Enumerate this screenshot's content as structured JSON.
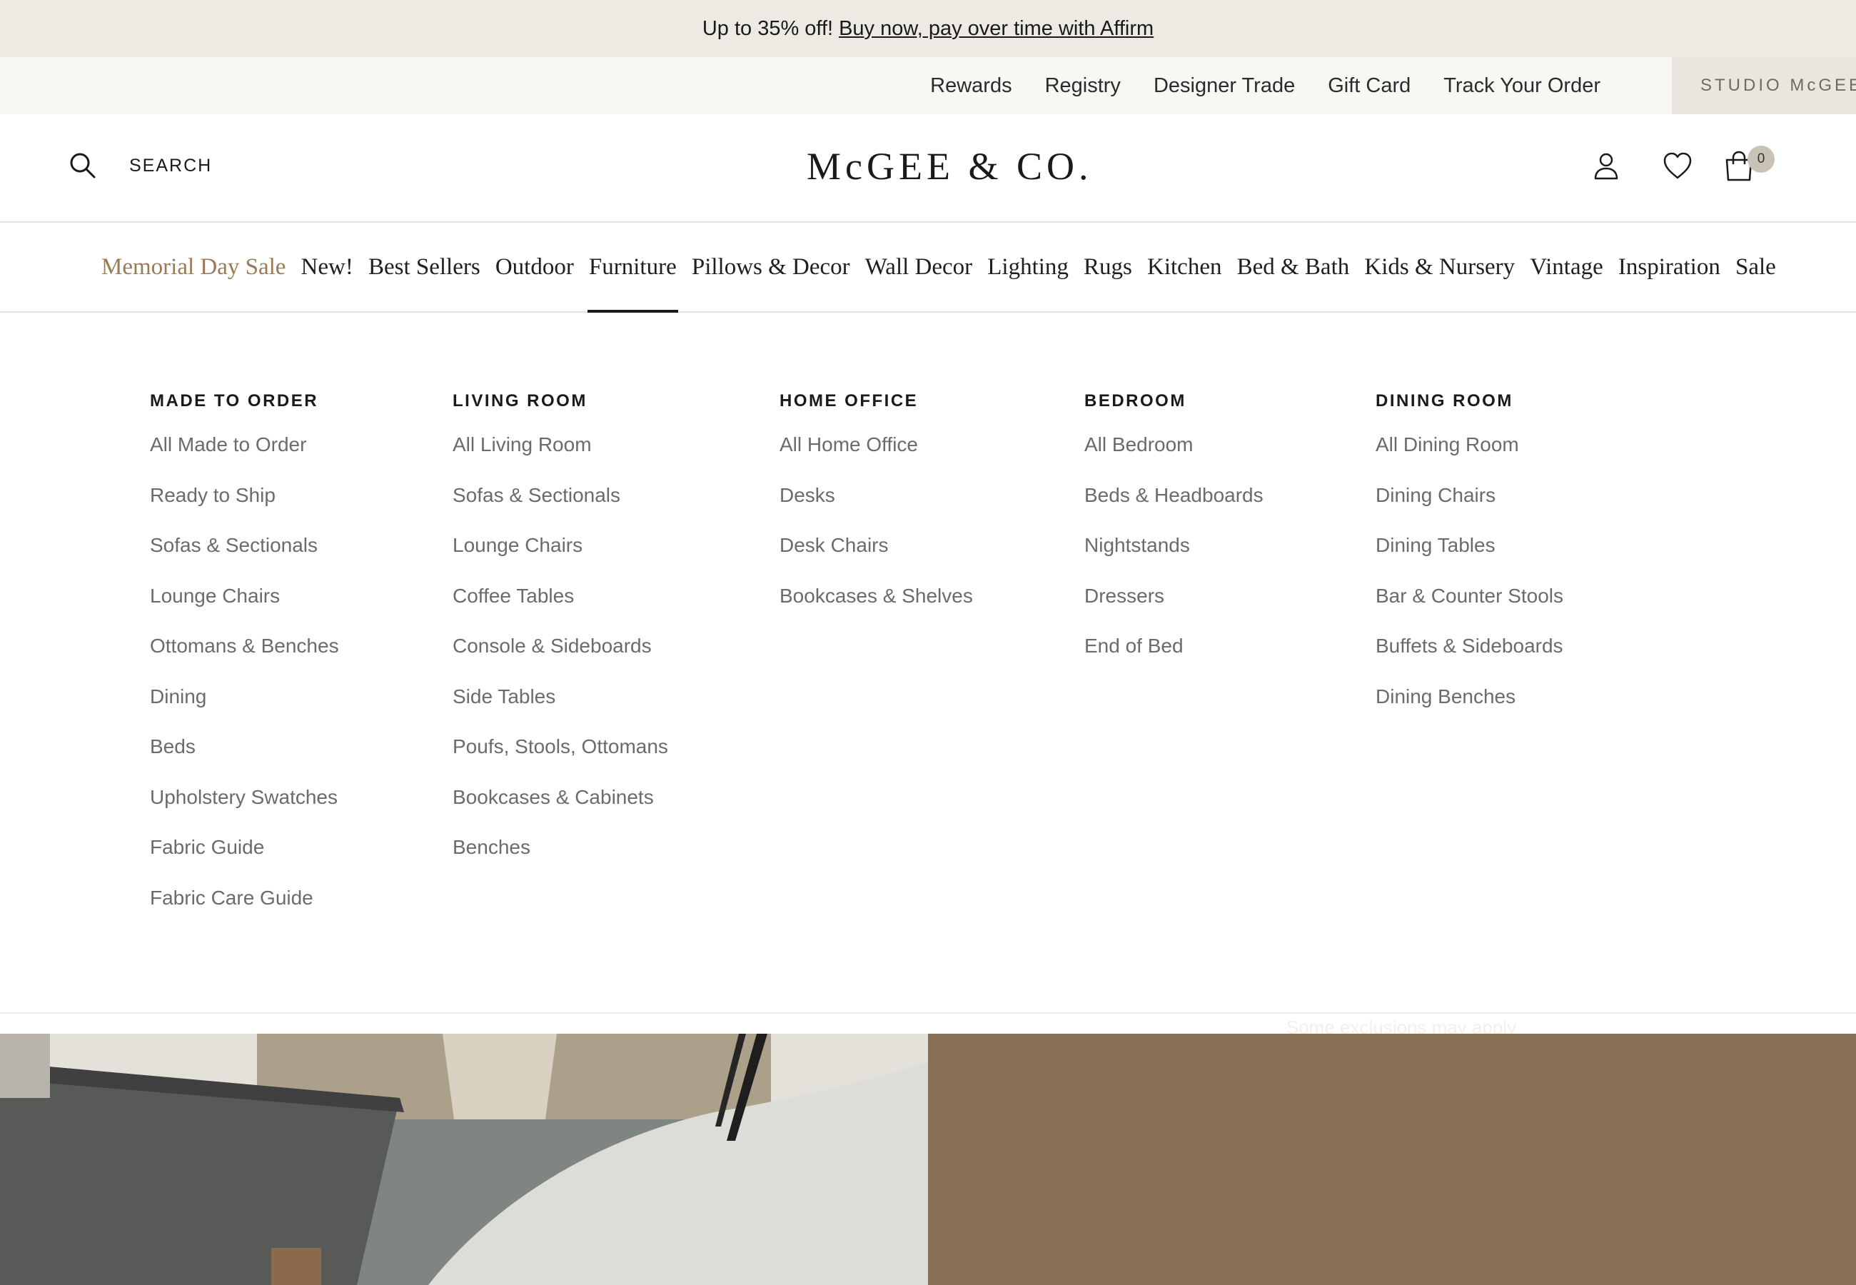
{
  "promo": {
    "text": "Up to 35% off!",
    "link": "Buy now, pay over time with Affirm"
  },
  "utility_links": [
    "Rewards",
    "Registry",
    "Designer Trade",
    "Gift Card",
    "Track Your Order"
  ],
  "studio_label": "STUDIO McGEE",
  "header": {
    "search_label": "SEARCH",
    "logo_text": "McGEE & CO.",
    "cart_count": "0"
  },
  "nav": {
    "items": [
      "Memorial Day Sale",
      "New!",
      "Best Sellers",
      "Outdoor",
      "Furniture",
      "Pillows & Decor",
      "Wall Decor",
      "Lighting",
      "Rugs",
      "Kitchen",
      "Bed & Bath",
      "Kids & Nursery",
      "Vintage",
      "Inspiration",
      "Sale"
    ],
    "active": "Furniture"
  },
  "menu": {
    "columns": [
      {
        "title": "MADE TO ORDER",
        "links": [
          "All Made to Order",
          "Ready to Ship",
          "Sofas & Sectionals",
          "Lounge Chairs",
          "Ottomans & Benches",
          "Dining",
          "Beds",
          "Upholstery Swatches",
          "Fabric Guide",
          "Fabric Care Guide"
        ]
      },
      {
        "title": "LIVING ROOM",
        "links": [
          "All Living Room",
          "Sofas & Sectionals",
          "Lounge Chairs",
          "Coffee Tables",
          "Console & Sideboards",
          "Side Tables",
          "Poufs, Stools, Ottomans",
          "Bookcases & Cabinets",
          "Benches"
        ]
      },
      {
        "title": "HOME OFFICE",
        "links": [
          "All Home Office",
          "Desks",
          "Desk Chairs",
          "Bookcases & Shelves"
        ]
      },
      {
        "title": "BEDROOM",
        "links": [
          "All Bedroom",
          "Beds & Headboards",
          "Nightstands",
          "Dressers",
          "End of Bed"
        ]
      },
      {
        "title": "DINING ROOM",
        "links": [
          "All Dining Room",
          "Dining Chairs",
          "Dining Tables",
          "Bar & Counter Stools",
          "Buffets & Sideboards",
          "Dining Benches"
        ]
      }
    ]
  },
  "hero": {
    "exclusions": "Some exclusions may apply"
  },
  "colors": {
    "promo_bg": "#edeae4",
    "utility_bg": "#f8f7f3",
    "sale_accent": "#9a7b56",
    "hero_panel": "#876f56"
  }
}
